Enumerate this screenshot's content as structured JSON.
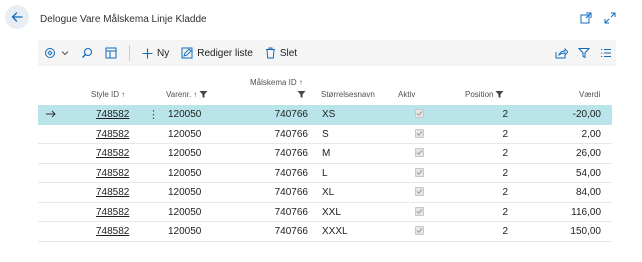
{
  "page": {
    "title": "Delogue Vare Målskema Linje Kladde"
  },
  "toolbar": {
    "new_label": "Ny",
    "edit_list_label": "Rediger liste",
    "delete_label": "Slet"
  },
  "columns": {
    "style_id": "Style ID",
    "varenr": "Varenr.",
    "maalskema_id": "Målskema ID",
    "storrelsesnavn": "Størrelsesnavn",
    "aktiv": "Aktiv",
    "position": "Position",
    "vaerdi": "Værdi"
  },
  "rows": [
    {
      "style_id": "748582",
      "varenr": "120050",
      "maalskema_id": "740766",
      "storrelsesnavn": "XS",
      "aktiv": true,
      "position": "2",
      "vaerdi": "-20,00"
    },
    {
      "style_id": "748582",
      "varenr": "120050",
      "maalskema_id": "740766",
      "storrelsesnavn": "S",
      "aktiv": true,
      "position": "2",
      "vaerdi": "2,00"
    },
    {
      "style_id": "748582",
      "varenr": "120050",
      "maalskema_id": "740766",
      "storrelsesnavn": "M",
      "aktiv": true,
      "position": "2",
      "vaerdi": "26,00"
    },
    {
      "style_id": "748582",
      "varenr": "120050",
      "maalskema_id": "740766",
      "storrelsesnavn": "L",
      "aktiv": true,
      "position": "2",
      "vaerdi": "54,00"
    },
    {
      "style_id": "748582",
      "varenr": "120050",
      "maalskema_id": "740766",
      "storrelsesnavn": "XL",
      "aktiv": true,
      "position": "2",
      "vaerdi": "84,00"
    },
    {
      "style_id": "748582",
      "varenr": "120050",
      "maalskema_id": "740766",
      "storrelsesnavn": "XXL",
      "aktiv": true,
      "position": "2",
      "vaerdi": "116,00"
    },
    {
      "style_id": "748582",
      "varenr": "120050",
      "maalskema_id": "740766",
      "storrelsesnavn": "XXXL",
      "aktiv": true,
      "position": "2",
      "vaerdi": "150,00"
    }
  ],
  "selected_row": 0,
  "colors": {
    "accent": "#0f6cbd",
    "selected_row": "#b9e4ea",
    "toolbar_bg": "#f5f5f5"
  }
}
